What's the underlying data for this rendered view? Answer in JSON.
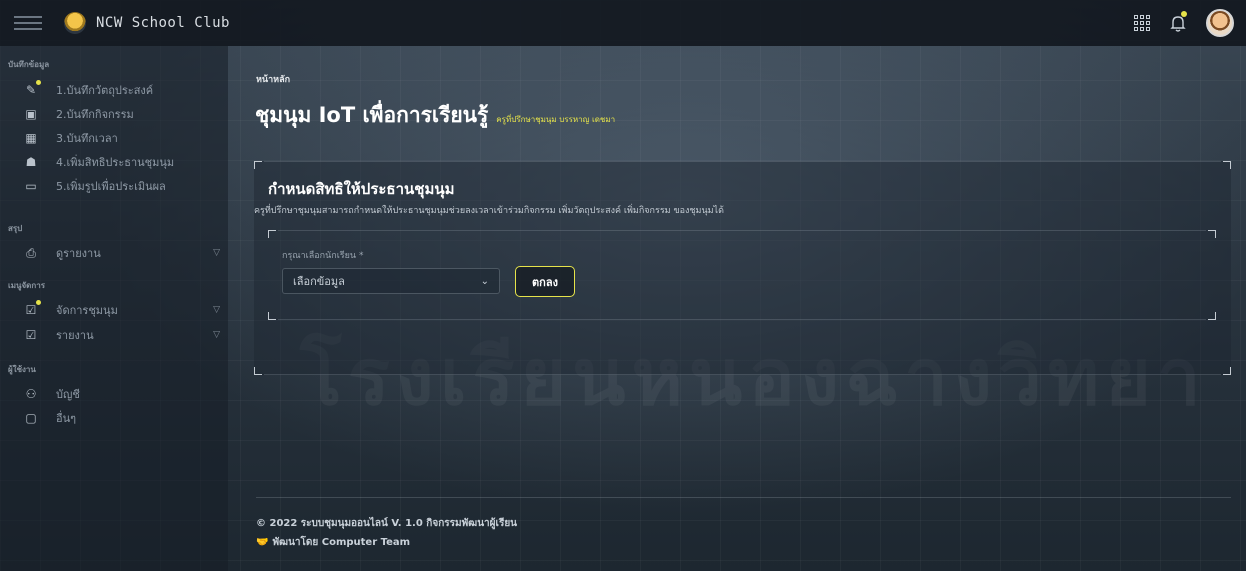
{
  "app": {
    "title": "NCW School Club"
  },
  "watermark": "โรงเรียนหนองฉางวิทยา",
  "sidebar": {
    "sections": [
      {
        "label": "บันทึกข้อมูล"
      },
      {
        "label": "สรุป"
      },
      {
        "label": "เมนูจัดการ"
      },
      {
        "label": "ผู้ใช้งาน"
      }
    ],
    "items": [
      {
        "label": "1.บันทึกวัตถุประสงค์",
        "icon": "edit-icon"
      },
      {
        "label": "2.บันทึกกิจกรรม",
        "icon": "calendar-check-icon"
      },
      {
        "label": "3.บันทึกเวลา",
        "icon": "calendar-icon"
      },
      {
        "label": "4.เพิ่มสิทธิประธานชุมนุม",
        "icon": "user-badge-icon"
      },
      {
        "label": "5.เพิ่มรูปเพื่อประเมินผล",
        "icon": "image-icon"
      },
      {
        "label": "ดูรายงาน",
        "icon": "printer-icon"
      },
      {
        "label": "จัดการชุมนุม",
        "icon": "clipboard-check-icon"
      },
      {
        "label": "รายงาน",
        "icon": "clipboard-check-icon"
      },
      {
        "label": "บัญชี",
        "icon": "users-icon"
      },
      {
        "label": "อื่นๆ",
        "icon": "calendar-outline-icon"
      }
    ]
  },
  "main": {
    "breadcrumb": "หน้าหลัก",
    "title": "ชุมนุม IoT เพื่อการเรียนรู้",
    "subtitle": "ครูที่ปรึกษาชุมนุม บรรหาญ เดชมา",
    "card": {
      "title": "กำหนดสิทธิให้ประธานชุมนุม",
      "description": "ครูที่ปรึกษาชุมนุมสามารถกำหนดให้ประธานชุมนุมช่วยลงเวลาเข้าร่วมกิจกรรม เพิ่มวัตถุประสงค์ เพิ่มกิจกรรม ของชุมนุมได้",
      "field_label": "กรุณาเลือกนักเรียน",
      "required_mark": "*",
      "select_value": "เลือกข้อมูล",
      "ok_label": "ตกลง"
    }
  },
  "footer": {
    "line1": "© 2022 ระบบชุมนุมออนไลน์ V. 1.0 กิจกรรมพัฒนาผู้เรียน",
    "line2": "พัฒนาโดย Computer Team"
  },
  "colors": {
    "accent": "#e6e34a",
    "background": "#1c2530"
  }
}
